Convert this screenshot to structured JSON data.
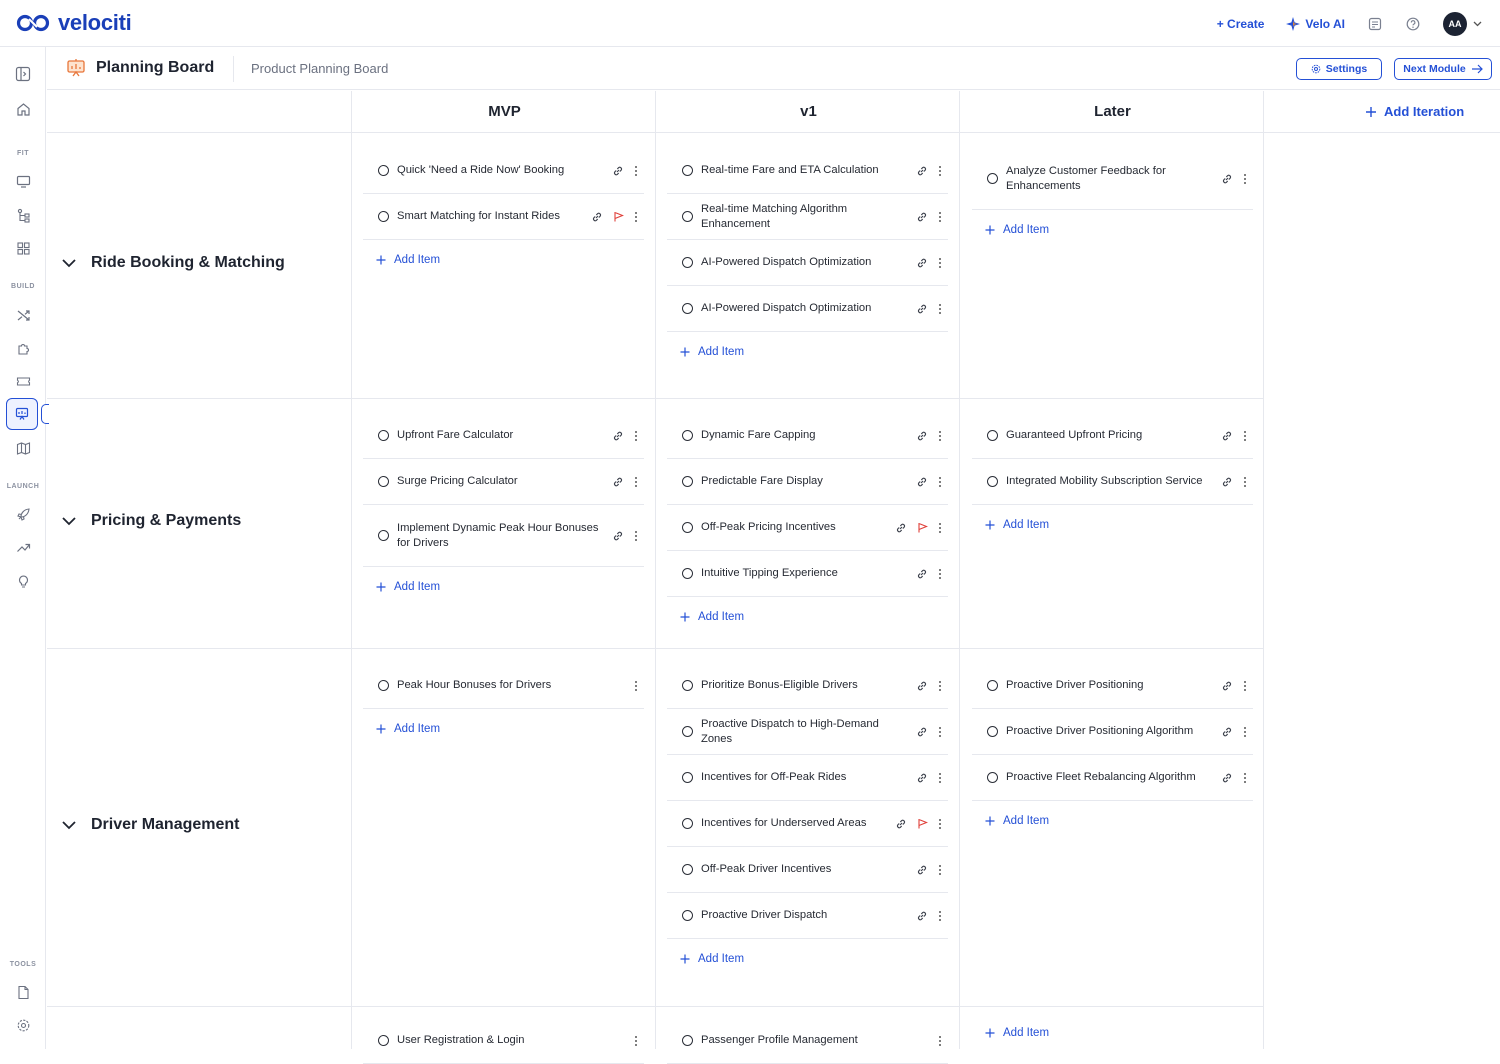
{
  "app": {
    "name": "velociti"
  },
  "topbar": {
    "create_label": "+ Create",
    "ai_label": "Velo AI",
    "avatar_initials": "AA"
  },
  "sidebar": {
    "sections": [
      "FIT",
      "BUILD",
      "LAUNCH",
      "TOOLS"
    ],
    "icons": [
      "panel-toggle-icon",
      "home-icon",
      "monitor-icon",
      "flow-icon",
      "grid-icon",
      "shuffle-icon",
      "puzzle-icon",
      "ticket-icon",
      "planning-board-icon",
      "map-icon",
      "rocket-icon",
      "trend-icon",
      "bulb-icon",
      "document-icon",
      "gear-icon"
    ]
  },
  "header": {
    "title": "Planning Board",
    "breadcrumb": "Product Planning Board",
    "settings_label": "Settings",
    "next_label": "Next Module"
  },
  "columns": [
    "MVP",
    "v1",
    "Later"
  ],
  "add_iteration_label": "Add Iteration",
  "add_item_label": "Add Item",
  "colors": {
    "accent": "#2450d6",
    "flag": "#e0403a",
    "border": "#e6e8ee"
  },
  "rows": [
    {
      "label": "Ride Booking & Matching",
      "cells": [
        [
          {
            "text": "Quick 'Need a Ride Now' Booking",
            "link": true,
            "flag": false
          },
          {
            "text": "Smart Matching for Instant Rides",
            "link": true,
            "flag": true
          }
        ],
        [
          {
            "text": "Real-time Fare and ETA Calculation",
            "link": true,
            "flag": false
          },
          {
            "text": "Real-time Matching Algorithm Enhancement",
            "link": true,
            "flag": false
          },
          {
            "text": "AI-Powered Dispatch Optimization",
            "link": true,
            "flag": false
          },
          {
            "text": "AI-Powered Dispatch Optimization",
            "link": true,
            "flag": false
          }
        ],
        [
          {
            "text": "Analyze Customer Feedback for Enhancements",
            "link": true,
            "flag": false
          }
        ]
      ]
    },
    {
      "label": "Pricing & Payments",
      "cells": [
        [
          {
            "text": "Upfront Fare Calculator",
            "link": true,
            "flag": false
          },
          {
            "text": "Surge Pricing Calculator",
            "link": true,
            "flag": false
          },
          {
            "text": "Implement Dynamic Peak Hour Bonuses for Drivers",
            "link": true,
            "flag": false
          }
        ],
        [
          {
            "text": "Dynamic Fare Capping",
            "link": true,
            "flag": false
          },
          {
            "text": "Predictable Fare Display",
            "link": true,
            "flag": false
          },
          {
            "text": "Off-Peak Pricing Incentives",
            "link": true,
            "flag": true
          },
          {
            "text": "Intuitive Tipping Experience",
            "link": true,
            "flag": false
          }
        ],
        [
          {
            "text": "Guaranteed Upfront Pricing",
            "link": true,
            "flag": false
          },
          {
            "text": "Integrated Mobility Subscription Service",
            "link": true,
            "flag": false
          }
        ]
      ]
    },
    {
      "label": "Driver Management",
      "cells": [
        [
          {
            "text": "Peak Hour Bonuses for Drivers",
            "link": false,
            "flag": false
          }
        ],
        [
          {
            "text": "Prioritize Bonus-Eligible Drivers",
            "link": true,
            "flag": false
          },
          {
            "text": "Proactive Dispatch to High-Demand Zones",
            "link": true,
            "flag": false
          },
          {
            "text": "Incentives for Off-Peak Rides",
            "link": true,
            "flag": false
          },
          {
            "text": "Incentives for Underserved Areas",
            "link": true,
            "flag": true
          },
          {
            "text": "Off-Peak Driver Incentives",
            "link": true,
            "flag": false
          },
          {
            "text": "Proactive Driver Dispatch",
            "link": true,
            "flag": false
          }
        ],
        [
          {
            "text": "Proactive Driver Positioning",
            "link": true,
            "flag": false
          },
          {
            "text": "Proactive Driver Positioning Algorithm",
            "link": true,
            "flag": false
          },
          {
            "text": "Proactive Fleet Rebalancing Algorithm",
            "link": true,
            "flag": false
          }
        ]
      ]
    },
    {
      "label": "",
      "cells": [
        [
          {
            "text": "User Registration & Login",
            "link": false,
            "flag": false
          }
        ],
        [
          {
            "text": "Passenger Profile Management",
            "link": false,
            "flag": false
          }
        ],
        []
      ]
    }
  ]
}
